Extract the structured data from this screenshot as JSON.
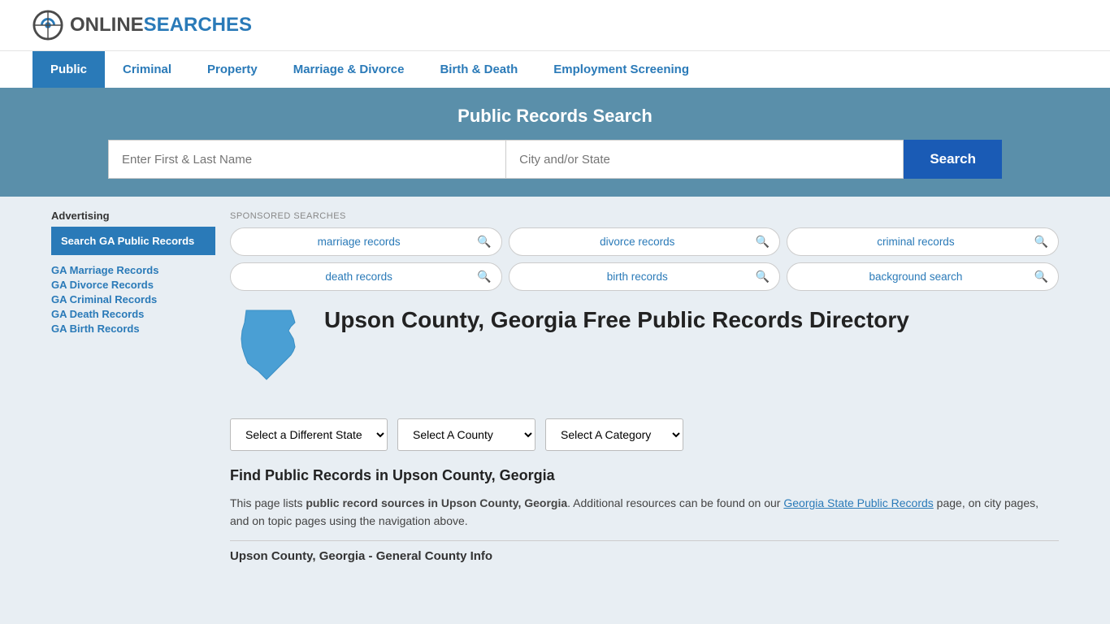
{
  "header": {
    "logo_text_plain": "ONLINE",
    "logo_text_colored": "SEARCHES"
  },
  "nav": {
    "items": [
      {
        "label": "Public",
        "active": true
      },
      {
        "label": "Criminal",
        "active": false
      },
      {
        "label": "Property",
        "active": false
      },
      {
        "label": "Marriage & Divorce",
        "active": false
      },
      {
        "label": "Birth & Death",
        "active": false
      },
      {
        "label": "Employment Screening",
        "active": false
      }
    ]
  },
  "search_banner": {
    "title": "Public Records Search",
    "name_placeholder": "Enter First & Last Name",
    "location_placeholder": "City and/or State",
    "button_label": "Search"
  },
  "sponsored": {
    "label": "SPONSORED SEARCHES",
    "pills": [
      {
        "text": "marriage records"
      },
      {
        "text": "divorce records"
      },
      {
        "text": "criminal records"
      },
      {
        "text": "death records"
      },
      {
        "text": "birth records"
      },
      {
        "text": "background search"
      }
    ]
  },
  "page": {
    "title": "Upson County, Georgia Free Public Records Directory",
    "dropdowns": {
      "state_label": "Select a Different State",
      "county_label": "Select A County",
      "category_label": "Select A Category"
    },
    "find_title": "Find Public Records in Upson County, Georgia",
    "find_text_1": "This page lists ",
    "find_bold": "public record sources in Upson County, Georgia",
    "find_text_2": ". Additional resources can be found on our ",
    "find_link_text": "Georgia State Public Records",
    "find_text_3": " page, on city pages, and on topic pages using the navigation above.",
    "county_info_label": "Upson County, Georgia - General County Info"
  },
  "sidebar": {
    "ad_label": "Advertising",
    "ad_box": "Search GA Public Records",
    "links": [
      {
        "label": "GA Marriage Records"
      },
      {
        "label": "GA Divorce Records"
      },
      {
        "label": "GA Criminal Records"
      },
      {
        "label": "GA Death Records"
      },
      {
        "label": "GA Birth Records"
      }
    ]
  }
}
